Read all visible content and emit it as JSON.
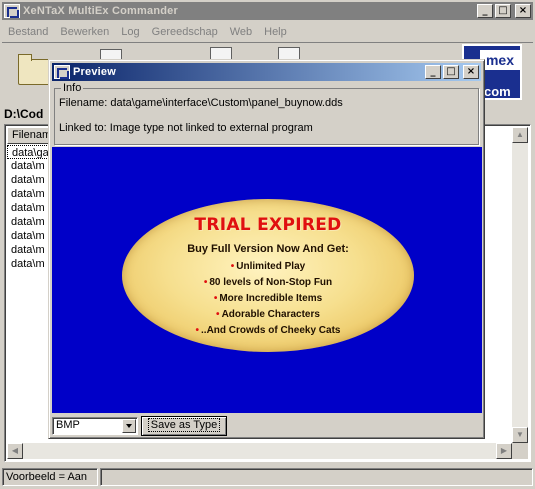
{
  "main_window": {
    "title": "XeNTaX MultiEx Commander",
    "menu": [
      "Bestand",
      "Bewerken",
      "Log",
      "Gereedschap",
      "Web",
      "Help"
    ],
    "path": "D:\\Cod",
    "logo_top": "mex",
    "logo_bottom": "com",
    "file_column_header": "Filenam",
    "files": [
      "data\\ga",
      "data\\m",
      "data\\m",
      "data\\m",
      "data\\m",
      "data\\m",
      "data\\m",
      "data\\m",
      "data\\m"
    ],
    "status": "Voorbeeld = Aan"
  },
  "preview": {
    "title": "Preview",
    "info_legend": "Info",
    "filename_line": "Filename: data\\game\\interface\\Custom\\panel_buynow.dds",
    "linked_line": "Linked to:   Image type not linked to external program",
    "image": {
      "headline": "TRIAL EXPIRED",
      "subheadline": "Buy Full Version Now And Get:",
      "bullets": [
        "Unlimited Play",
        "80 levels of Non-Stop Fun",
        "More Incredible Items",
        "Adorable Characters",
        "..And Crowds of Cheeky Cats"
      ]
    },
    "format_value": "BMP",
    "save_label": "Save as Type"
  },
  "colors": {
    "title_active_start": "#0a246a",
    "title_active_end": "#a6caf0",
    "title_inactive": "#808080",
    "preview_background": "#0000c8",
    "headline_red": "#e01010",
    "window_face": "#d4d0c8"
  },
  "icons": [
    "app-logo-icon",
    "open-folder-icon",
    "document-icon",
    "minimize-icon",
    "maximize-icon",
    "close-icon",
    "dropdown-arrow-icon"
  ]
}
